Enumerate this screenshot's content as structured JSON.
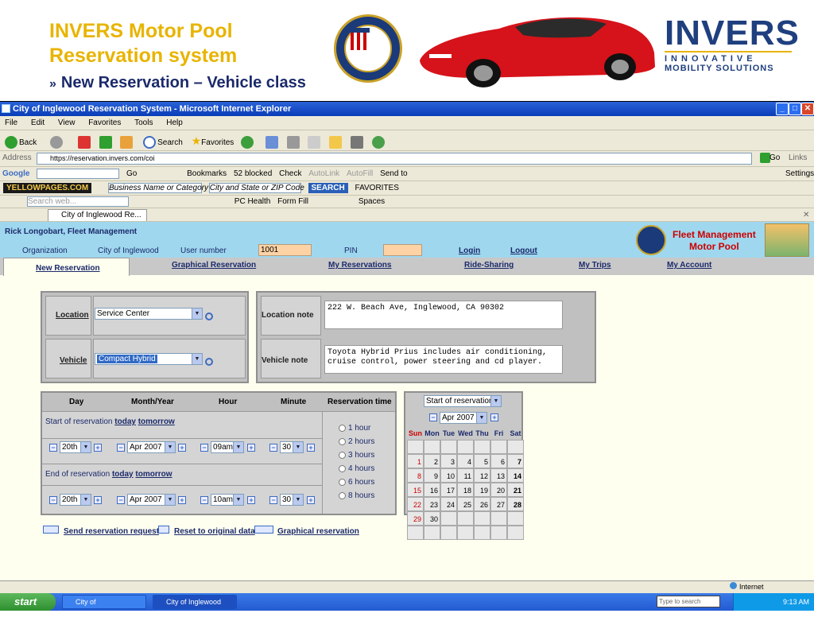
{
  "slide": {
    "title_line1": "INVERS Motor Pool",
    "title_line2": "Reservation system",
    "subtitle_arrow": "»",
    "subtitle": "New Reservation – Vehicle class",
    "logo_name": "INVERS",
    "logo_tag1": "INNOVATIVE",
    "logo_tag2": "MOBILITY SOLUTIONS"
  },
  "window": {
    "title": "City of Inglewood Reservation System - Microsoft Internet Explorer",
    "min": "_",
    "max": "□",
    "close": "✕"
  },
  "menu": [
    "File",
    "Edit",
    "View",
    "Favorites",
    "Tools",
    "Help"
  ],
  "toolbar": {
    "back": "Back",
    "search": "Search",
    "favorites": "Favorites"
  },
  "address": {
    "label": "Address",
    "value": "https://reservation.invers.com/coi",
    "go": "Go",
    "links": "Links"
  },
  "google_bar": {
    "brand": "Google",
    "go": "Go",
    "bookmarks": "Bookmarks",
    "blocked": "52 blocked",
    "check": "Check",
    "autolink": "AutoLink",
    "autofill": "AutoFill",
    "sendto": "Send to",
    "settings": "Settings"
  },
  "yp_bar": {
    "brand": "YELLOWPAGES.COM",
    "category": "Business Name or Category",
    "city": "City and State or ZIP Code",
    "search": "SEARCH",
    "favorites": "FAVORITES"
  },
  "links_bar": {
    "search_placeholder": "Search web...",
    "pc_health": "PC Health",
    "form_fill": "Form Fill",
    "spaces": "Spaces"
  },
  "tab": {
    "label": "City of Inglewood Re..."
  },
  "app": {
    "user": "Rick Longobart, Fleet Management",
    "org_label": "Organization",
    "org_value": "City of Inglewood",
    "usernum_label": "User number",
    "usernum_value": "1001",
    "pin_label": "PIN",
    "login": "Login",
    "logout": "Logout",
    "brand_line1": "Fleet Management",
    "brand_line2": "Motor Pool",
    "tabs": [
      "New Reservation",
      "Graphical Reservation",
      "My Reservations",
      "Ride-Sharing",
      "My Trips",
      "My Account"
    ],
    "location_label": "Location",
    "location_value": "Service Center",
    "vehicle_label": "Vehicle",
    "vehicle_value": "Compact Hybrid",
    "location_note_label": "Location note",
    "location_note": "222 W. Beach Ave, Inglewood, CA 90302",
    "vehicle_note_label": "Vehicle note",
    "vehicle_note": "Toyota Hybrid Prius includes air conditioning, cruise control, power steering and cd player.",
    "col_day": "Day",
    "col_month": "Month/Year",
    "col_hour": "Hour",
    "col_minute": "Minute",
    "col_resv": "Reservation time",
    "start_label": "Start of reservation",
    "end_label": "End of reservation",
    "today": "today",
    "tomorrow": "tomorrow",
    "start": {
      "day": "20th",
      "month": "Apr 2007",
      "hour": "09am",
      "minute": "30"
    },
    "end": {
      "day": "20th",
      "month": "Apr 2007",
      "hour": "10am",
      "minute": "30"
    },
    "durations": [
      "1 hour",
      "2 hours",
      "3 hours",
      "4 hours",
      "6 hours",
      "8 hours"
    ],
    "cal_mode": "Start of reservation",
    "cal_month": "Apr 2007",
    "weekdays": [
      "Sun",
      "Mon",
      "Tue",
      "Wed",
      "Thu",
      "Fri",
      "Sat"
    ],
    "cal_rows": [
      [
        "",
        "",
        "",
        "",
        "",
        "",
        ""
      ],
      [
        "1",
        "2",
        "3",
        "4",
        "5",
        "6",
        "7"
      ],
      [
        "8",
        "9",
        "10",
        "11",
        "12",
        "13",
        "14"
      ],
      [
        "15",
        "16",
        "17",
        "18",
        "19",
        "20",
        "21"
      ],
      [
        "22",
        "23",
        "24",
        "25",
        "26",
        "27",
        "28"
      ],
      [
        "29",
        "30",
        "",
        "",
        "",
        "",
        ""
      ],
      [
        "",
        "",
        "",
        "",
        "",
        "",
        ""
      ]
    ],
    "send": "Send reservation request",
    "reset": "Reset to original data",
    "graphical": "Graphical reservation"
  },
  "status": {
    "zone": "Internet"
  },
  "taskbar": {
    "start": "start",
    "task1": "City of Inglewood_Re...",
    "task2": "City of Inglewood Re...",
    "search_placeholder": "Type to search",
    "clock": "9:13 AM"
  },
  "colors": {
    "slide_title": "#e8b400",
    "nav_blue": "#1b2a6b",
    "header_bg": "#9fd7ee",
    "page_bg": "#fffff0"
  }
}
